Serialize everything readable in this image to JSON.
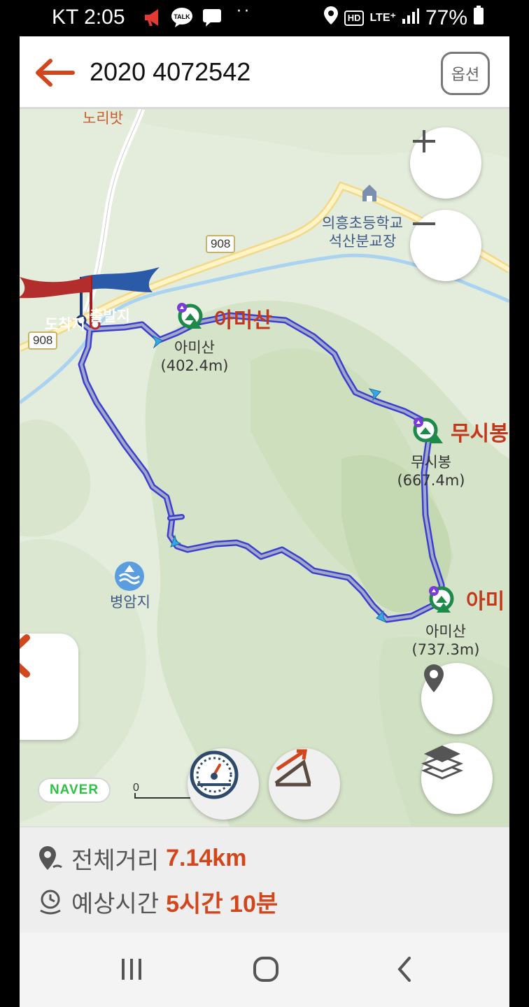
{
  "status_bar": {
    "carrier_time": "KT 2:05",
    "notif_icons": [
      "megaphone-icon",
      "talk-icon",
      "message-icon"
    ],
    "talk_label": "TALK",
    "overflow_dots": "··",
    "net_badge": "HD",
    "lte_label": "LTE⁺",
    "battery": "77%"
  },
  "header": {
    "title": "2020 4072542",
    "option_label": "옵션"
  },
  "map": {
    "top_cut_label": "노리밧",
    "road_sign_1": "908",
    "road_sign_2": "908",
    "school_line1": "의흥초등학교",
    "school_line2": "석산분교장",
    "flag_end": "도착지",
    "flag_start": "출발지",
    "peak1": {
      "big": "아미산",
      "name": "아미산",
      "height": "(402.4m)"
    },
    "peak2": {
      "big": "무시봉",
      "name": "무시봉",
      "height": "(667.4m)"
    },
    "peak3": {
      "big": "아미",
      "name": "아미산",
      "height": "(737.3m)"
    },
    "reservoir": "병암지",
    "naver": "NAVER",
    "scale_zero": "0"
  },
  "summary": {
    "distance_label": "전체거리",
    "distance_value": "7.14km",
    "time_label": "예상시간",
    "time_value": "5시간 10분"
  },
  "colors": {
    "accent": "#d2461d",
    "route": "#3a3fd0",
    "route_fill": "#a3a8c8"
  }
}
